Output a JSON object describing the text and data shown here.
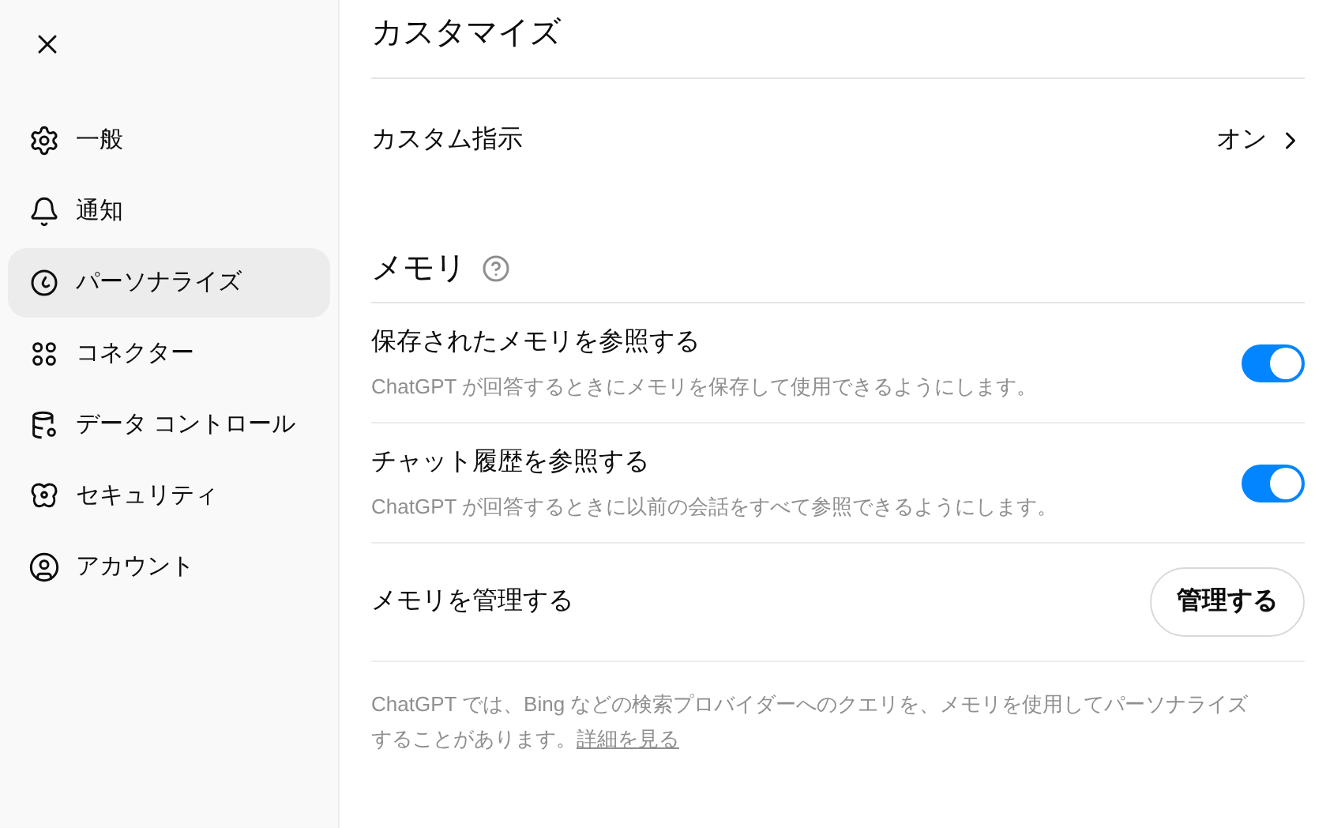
{
  "sidebar": {
    "items": [
      {
        "label": "一般",
        "selected": false
      },
      {
        "label": "通知",
        "selected": false
      },
      {
        "label": "パーソナライズ",
        "selected": true
      },
      {
        "label": "コネクター",
        "selected": false
      },
      {
        "label": "データ コントロール",
        "selected": false
      },
      {
        "label": "セキュリティ",
        "selected": false
      },
      {
        "label": "アカウント",
        "selected": false
      }
    ]
  },
  "page_title": "カスタマイズ",
  "custom_instructions": {
    "label": "カスタム指示",
    "value": "オン"
  },
  "memory": {
    "title": "メモリ",
    "toggles": [
      {
        "label": "保存されたメモリを参照する",
        "description": "ChatGPT が回答するときにメモリを保存して使用できるようにします。",
        "on": true
      },
      {
        "label": "チャット履歴を参照する",
        "description": "ChatGPT が回答するときに以前の会話をすべて参照できるようにします。",
        "on": true
      }
    ],
    "manage": {
      "label": "メモリを管理する",
      "button": "管理する"
    },
    "note": "ChatGPT では、Bing などの検索プロバイダーへのクエリを、メモリを使用してパーソナライズすることがあります。",
    "note_link": "詳細を見る"
  }
}
